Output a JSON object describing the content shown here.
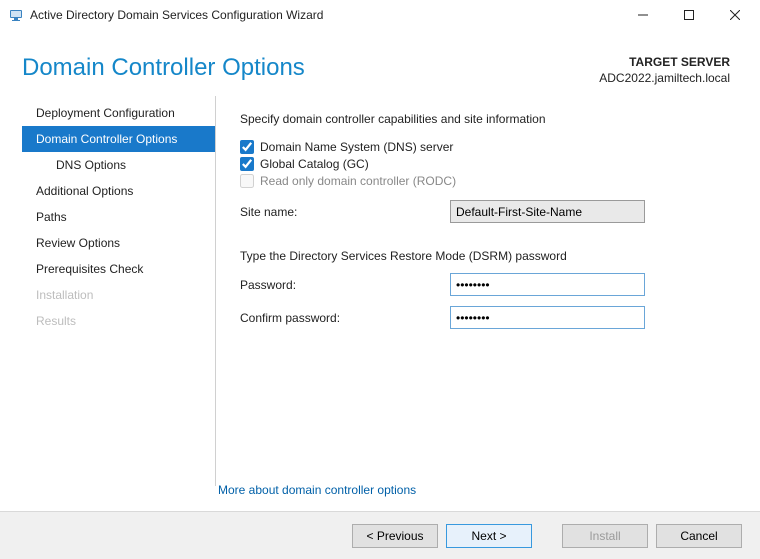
{
  "window": {
    "title": "Active Directory Domain Services Configuration Wizard"
  },
  "header": {
    "page_title": "Domain Controller Options",
    "target_label": "TARGET SERVER",
    "target_value": "ADC2022.jamiltech.local"
  },
  "sidebar": {
    "items": [
      {
        "label": "Deployment Configuration",
        "active": false
      },
      {
        "label": "Domain Controller Options",
        "active": true
      },
      {
        "label": "DNS Options",
        "child": true
      },
      {
        "label": "Additional Options"
      },
      {
        "label": "Paths"
      },
      {
        "label": "Review Options"
      },
      {
        "label": "Prerequisites Check"
      },
      {
        "label": "Installation",
        "disabled": true
      },
      {
        "label": "Results",
        "disabled": true
      }
    ]
  },
  "main": {
    "capabilities_title": "Specify domain controller capabilities and site information",
    "cb_dns": "Domain Name System (DNS) server",
    "cb_gc": "Global Catalog (GC)",
    "cb_rodc": "Read only domain controller (RODC)",
    "site_name_label": "Site name:",
    "site_name_value": "Default-First-Site-Name",
    "dsrm_title": "Type the Directory Services Restore Mode (DSRM) password",
    "password_label": "Password:",
    "password_value": "••••••••",
    "confirm_label": "Confirm password:",
    "confirm_value": "••••••••",
    "more_link": "More about domain controller options"
  },
  "footer": {
    "previous": "< Previous",
    "next": "Next >",
    "install": "Install",
    "cancel": "Cancel"
  }
}
